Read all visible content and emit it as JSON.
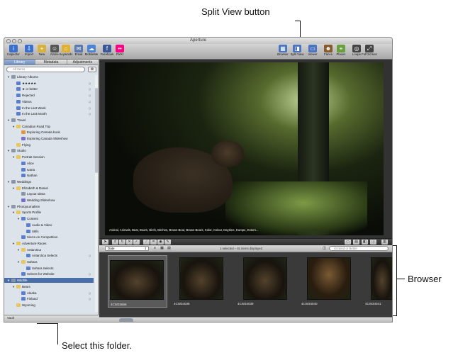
{
  "annotations": {
    "split_view": "Split View button",
    "browser": "Browser",
    "select_folder": "Select this folder."
  },
  "window": {
    "title": "Aperture"
  },
  "toolbar": {
    "left": [
      {
        "label": "Inspector",
        "icon": "info-icon",
        "color": "#3a6fd0"
      },
      {
        "label": "Import",
        "icon": "import-arrow-icon",
        "color": "#3a6fd0"
      },
      {
        "label": "New",
        "icon": "new-project-icon",
        "color": "#d8b040"
      },
      {
        "label": "Name",
        "icon": "name-person-icon",
        "color": "#555555"
      },
      {
        "label": "Keywords",
        "icon": "keywords-tag-icon",
        "color": "#e0b030"
      },
      {
        "label": "Email",
        "icon": "email-icon",
        "color": "#5a78b0"
      },
      {
        "label": "MobileMe",
        "icon": "mobileme-cloud-icon",
        "color": "#4a84d8"
      },
      {
        "label": "Facebook",
        "icon": "facebook-icon",
        "color": "#3b5998"
      },
      {
        "label": "Flickr",
        "icon": "flickr-icon",
        "color": "#ff0084"
      }
    ],
    "right": [
      {
        "label": "Browser",
        "icon": "browser-grid-icon",
        "color": "#4a74c0"
      },
      {
        "label": "Split View",
        "icon": "split-view-icon",
        "color": "#4a74c0"
      },
      {
        "label": "Viewer",
        "icon": "viewer-icon",
        "color": "#4a74c0"
      },
      {
        "label": "Faces",
        "icon": "faces-icon",
        "color": "#8a5a2a"
      },
      {
        "label": "Places",
        "icon": "places-map-icon",
        "color": "#6aa040"
      },
      {
        "label": "Loupe",
        "icon": "loupe-icon",
        "color": "#444444"
      },
      {
        "label": "Full Screen",
        "icon": "full-screen-icon",
        "color": "#444444"
      }
    ]
  },
  "sidebar": {
    "tabs": [
      "Library",
      "Metadata",
      "Adjustments"
    ],
    "search_placeholder": "All Items",
    "footer_label": "Vault",
    "tree": [
      {
        "label": "Library Albums",
        "level": 0,
        "icon": "gr",
        "tri": "▼"
      },
      {
        "label": "★★★★★",
        "level": 1,
        "icon": "bl",
        "tri": "",
        "count": "Q"
      },
      {
        "label": "★ or better",
        "level": 1,
        "icon": "bl",
        "tri": "",
        "count": "Q"
      },
      {
        "label": "Rejected",
        "level": 1,
        "icon": "bl",
        "tri": "",
        "count": "Q"
      },
      {
        "label": "Videos",
        "level": 1,
        "icon": "bl",
        "tri": "",
        "count": "Q"
      },
      {
        "label": "In the Last Week",
        "level": 1,
        "icon": "bl",
        "tri": "",
        "count": "Q"
      },
      {
        "label": "In the Last Month",
        "level": 1,
        "icon": "bl",
        "tri": "",
        "count": "Q"
      },
      {
        "label": "Travel",
        "level": 0,
        "icon": "gr",
        "tri": "▼"
      },
      {
        "label": "Canadian Road Trip",
        "level": 1,
        "icon": "ye",
        "tri": "▼"
      },
      {
        "label": "Exploring Canada book",
        "level": 2,
        "icon": "or",
        "tri": ""
      },
      {
        "label": "Exploring Canada Slideshow",
        "level": 2,
        "icon": "pu",
        "tri": ""
      },
      {
        "label": "Flying",
        "level": 1,
        "icon": "ye",
        "tri": ""
      },
      {
        "label": "Studio",
        "level": 0,
        "icon": "gr",
        "tri": "▼"
      },
      {
        "label": "Portrait Session",
        "level": 1,
        "icon": "ye",
        "tri": "▼"
      },
      {
        "label": "Alice",
        "level": 2,
        "icon": "bl",
        "tri": ""
      },
      {
        "label": "Ivana",
        "level": 2,
        "icon": "bl",
        "tri": ""
      },
      {
        "label": "Nathan",
        "level": 2,
        "icon": "bl",
        "tri": ""
      },
      {
        "label": "Weddings",
        "level": 0,
        "icon": "gr",
        "tri": "▼"
      },
      {
        "label": "Elizabeth & Daniel",
        "level": 1,
        "icon": "ye",
        "tri": "▼"
      },
      {
        "label": "Layout Ideas",
        "level": 2,
        "icon": "gr",
        "tri": ""
      },
      {
        "label": "Wedding Slideshow",
        "level": 2,
        "icon": "pu",
        "tri": ""
      },
      {
        "label": "Photojournalism",
        "level": 0,
        "icon": "gr",
        "tri": "▼"
      },
      {
        "label": "Sports Profile",
        "level": 1,
        "icon": "ye",
        "tri": "▼"
      },
      {
        "label": "Content",
        "level": 2,
        "icon": "bl",
        "tri": "▼"
      },
      {
        "label": "Audio & Video",
        "level": 3,
        "icon": "bl",
        "tri": ""
      },
      {
        "label": "Stills",
        "level": 3,
        "icon": "bl",
        "tri": ""
      },
      {
        "label": "Sierra on Competition",
        "level": 2,
        "icon": "bl",
        "tri": ""
      },
      {
        "label": "Adventure Races",
        "level": 1,
        "icon": "ye",
        "tri": "▼"
      },
      {
        "label": "Antarctica",
        "level": 2,
        "icon": "ye",
        "tri": "▼"
      },
      {
        "label": "Antarctica Selects",
        "level": 3,
        "icon": "bl",
        "tri": "",
        "count": "Q"
      },
      {
        "label": "Sahara",
        "level": 2,
        "icon": "ye",
        "tri": "▼"
      },
      {
        "label": "Sahara Selects",
        "level": 3,
        "icon": "bl",
        "tri": ""
      },
      {
        "label": "Selects for Website",
        "level": 2,
        "icon": "bl",
        "tri": "",
        "count": "Q"
      },
      {
        "label": "Wildlife",
        "level": 0,
        "icon": "gr",
        "tri": "▼",
        "selected": true
      },
      {
        "label": "Bears",
        "level": 1,
        "icon": "ye",
        "tri": "▼"
      },
      {
        "label": "Alaska",
        "level": 2,
        "icon": "bl",
        "tri": "",
        "count": "Q"
      },
      {
        "label": "Finland",
        "level": 2,
        "icon": "bl",
        "tri": "",
        "count": "Q"
      },
      {
        "label": "Wyoming",
        "level": 1,
        "icon": "ye",
        "tri": ""
      }
    ]
  },
  "viewer": {
    "keywords": "Animal, Animals, Bear, Bears, Birch, Birches, Brown Bear, Brown Bears, Color, Colour, Daytime, Europe, Extern..."
  },
  "browser_bar": {
    "sort": "Date",
    "status": "1 selected – 81 items displayed",
    "filter_placeholder": "Unrated or Better"
  },
  "browser": {
    "thumbs": [
      {
        "name": "4CW33666",
        "selected": true
      },
      {
        "name": "4CW34038",
        "selected": false
      },
      {
        "name": "4CW34039",
        "selected": false
      },
      {
        "name": "4CW34040",
        "selected": false
      },
      {
        "name": "4CW34041",
        "selected": false
      }
    ]
  }
}
